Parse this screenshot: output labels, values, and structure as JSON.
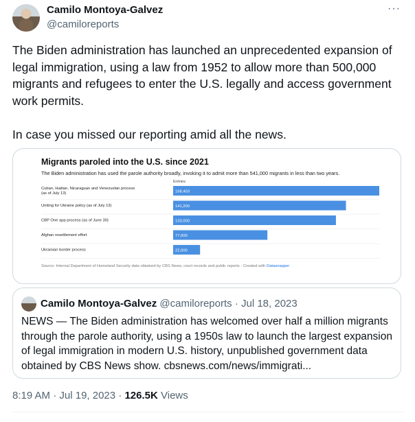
{
  "author": {
    "name": "Camilo Montoya-Galvez",
    "handle": "@camiloreports"
  },
  "more_icon": "···",
  "tweet_text": "The Biden administration has launched an unprecedented expansion of legal immigration, using a law from 1952 to allow more than 500,000 migrants and refugees to enter the U.S. legally and access government work permits.\n\nIn case you missed our reporting amid all the news.",
  "chart_data": {
    "type": "bar",
    "title": "Migrants paroled into the U.S. since 2021",
    "subtitle": "The Biden administration has used the parole authority broadly, invoking it to admit more than 541,000 migrants in less than two years.",
    "column_header": "Entries",
    "categories": [
      "Cuban, Haitian, Nicaraguan and Venezuelan process (as of July 13)",
      "Uniting for Ukraine policy (as of July 13)",
      "CBP One app process (as of June 30)",
      "Afghan resettlement effort",
      "Ukrainian border process"
    ],
    "values": [
      168403,
      141200,
      133000,
      77000,
      22000
    ],
    "value_labels": [
      "168,403",
      "141,200",
      "133,000",
      "77,000",
      "22,000"
    ],
    "xlim": [
      0,
      168403
    ],
    "bar_color": "#4a90e2",
    "source_text": "Source: Internal Department of Homeland Security data obtained by CBS News, court records and public reports · Created with ",
    "source_link": "Datawrapper"
  },
  "quote": {
    "name": "Camilo Montoya-Galvez",
    "handle": "@camiloreports",
    "date": "Jul 18, 2023",
    "text": "NEWS — The Biden administration has welcomed over half a million migrants through the parole authority, using a 1950s law to launch the largest expansion of legal immigration in modern U.S. history, unpublished government data obtained by CBS News show. cbsnews.com/news/immigrati..."
  },
  "meta": {
    "time": "8:19 AM",
    "date": "Jul 19, 2023",
    "views_count": "126.5K",
    "views_label": "Views"
  }
}
